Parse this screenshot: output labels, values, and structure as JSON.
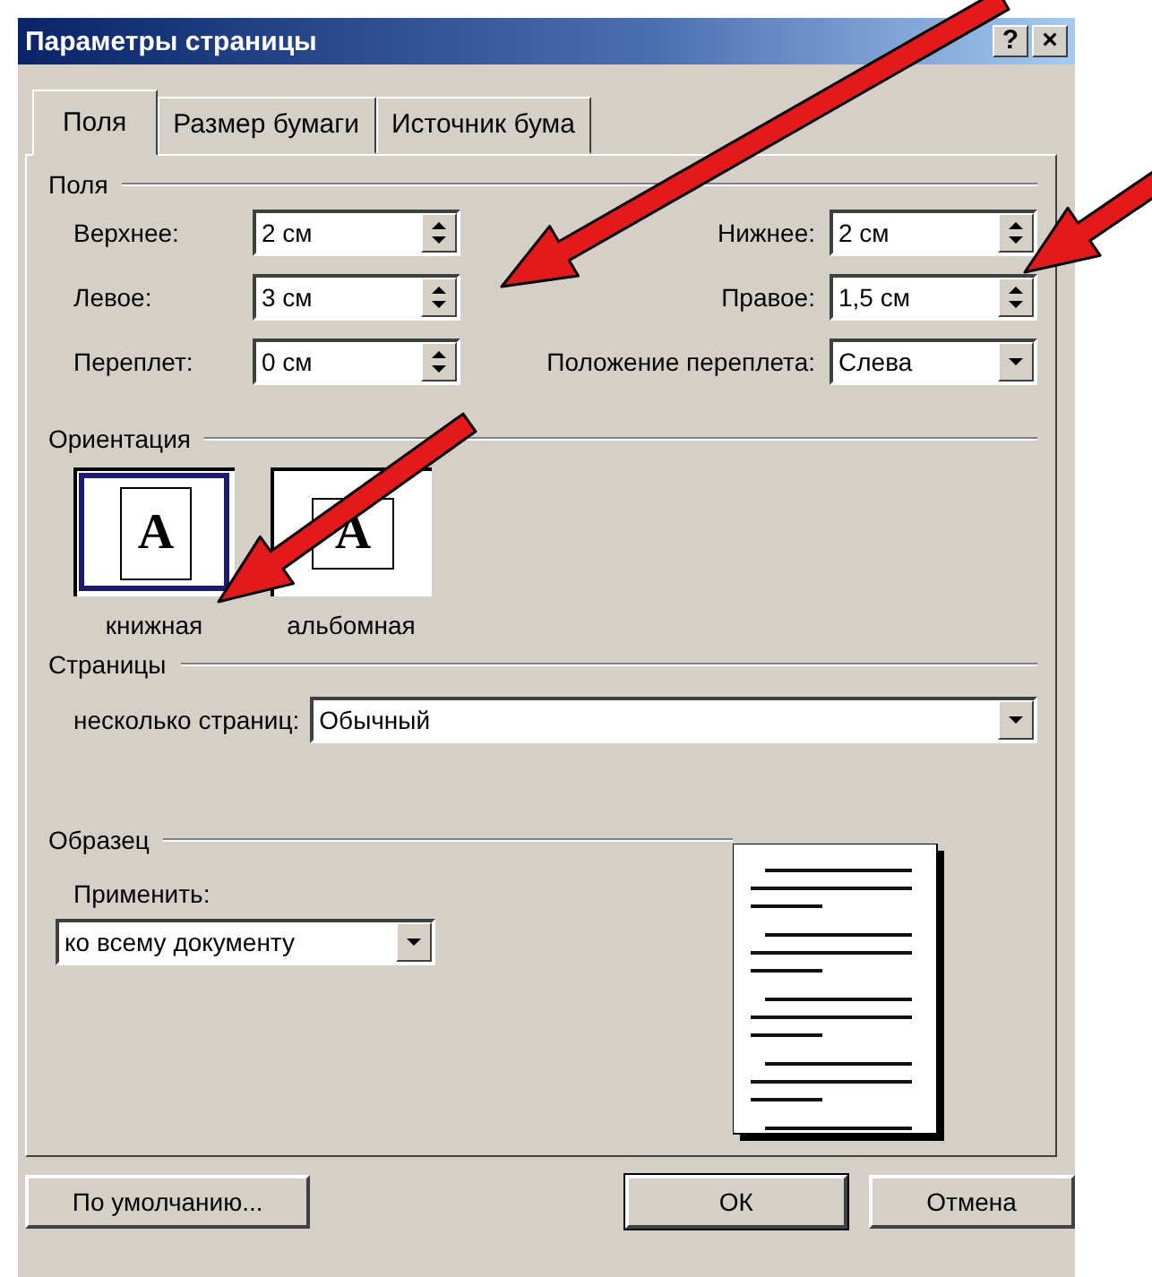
{
  "window": {
    "title": "Параметры страницы",
    "buttons": [
      "?",
      "×"
    ]
  },
  "tabs": [
    {
      "label": "Поля",
      "selected": true
    },
    {
      "label": "Размер бумаги",
      "selected": false
    },
    {
      "label": "Источник бума",
      "selected": false
    }
  ],
  "margins": {
    "title": "Поля",
    "left_fields": [
      {
        "label": "Верхнее:",
        "value": "2 см",
        "kind": "spin"
      },
      {
        "label": "Левое:",
        "value": "3 см",
        "kind": "spin"
      },
      {
        "label": "Переплет:",
        "value": "0 см",
        "kind": "spin"
      }
    ],
    "right_fields": [
      {
        "label": "Нижнее:",
        "value": "2 см",
        "kind": "spin"
      },
      {
        "label": "Правое:",
        "value": "1,5 см",
        "kind": "spin"
      },
      {
        "label": "Положение переплета:",
        "value": "Слева",
        "kind": "dropdown"
      }
    ]
  },
  "orientation": {
    "title": "Ориентация",
    "options": [
      {
        "label": "книжная",
        "letter": "A",
        "selected": true
      },
      {
        "label": "альбомная",
        "letter": "A",
        "selected": false
      }
    ]
  },
  "pages": {
    "title": "Страницы",
    "label": "несколько страниц:",
    "value": "Обычный"
  },
  "sample": {
    "title": "Образец",
    "apply_label": "Применить:",
    "apply_value": "ко всему документу"
  },
  "footer": [
    {
      "label": "По умолчанию...",
      "default": false
    },
    {
      "label": "ОК",
      "default": true
    },
    {
      "label": "Отмена",
      "default": false
    }
  ]
}
